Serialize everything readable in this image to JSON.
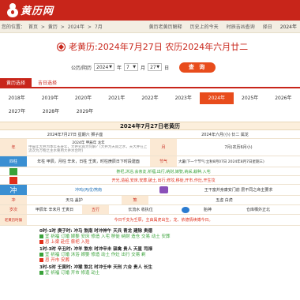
{
  "brand": {
    "logo_text": "黄历网"
  },
  "nav": {
    "crumbs": [
      "您的位置：",
      "首页",
      ">",
      "黄历",
      ">",
      "2024年",
      ">",
      "7月"
    ],
    "links": [
      "黄历老黄历解释",
      "历史上的今天",
      "时辰吉凶查询",
      "择日",
      "2024年"
    ]
  },
  "title": "老黄历:2024年7月27日 农历2024年六月廿二",
  "picker": {
    "label": "公历/阴历",
    "year": "2024",
    "month": "7",
    "day": "27",
    "search_label": "查 询"
  },
  "tabs": [
    "黄历选择",
    "吉日选择"
  ],
  "years": [
    [
      "2018年",
      "2019年",
      "2020年",
      "2021年",
      "2022年",
      "2023年",
      "2024年",
      "2025年",
      "2026年"
    ],
    [
      "2027年",
      "2028年",
      "2029年"
    ]
  ],
  "active_year": "2024年",
  "almanac": {
    "title": "2024年7月27日老黄历",
    "r1": {
      "left": "2024年7月27日 星期六 狮子座",
      "right": "2024年六月(小) 廿二 属龙"
    },
    "r2": {
      "label_l": "年",
      "mid_l": "2024年 甲辰年 龙年",
      "sub_l": "甲辰年大井为本年长寿年，大井究竟为何解？(大井为天雨之水，天大井在上流次为万物之主水要用大井水合时)",
      "label_r": "月",
      "right": "7月(农历6月小)"
    },
    "r3": {
      "label_l": "四柱",
      "left": "年柱 甲辰，月柱 辛未，日柱 壬寅，时柱庚辰日下时段建酉",
      "label_r": "节气",
      "right": "大暑(下一个节气:立秋8月07日 2024年8月7日星期三)"
    },
    "yi": "祭祀 沐浴 会亲友 出行 纳采 嫁娶 开市 订盟 入宅 动土 安床 修造 上梁",
    "yi_line": "祭祀,沐浴,会亲友,祈福,出行,纳财,嫁娶,纳采,栽种,入宅",
    "ji_line": "开光,造船,安床,安葬,破土,出行,修坟,移徙,开市,作灶,开生坟",
    "chong": "冲鸡(丙戌)煞南",
    "shen": "王干富并身康安门前 层不同之命主要求",
    "r7": {
      "a": "冲",
      "b": "煞",
      "c": "天马 盖护",
      "d": "五虚 白虎"
    },
    "r8": {
      "a": "岁次",
      "b": "甲辰年 辛未月 壬寅日",
      "c": "五行",
      "d": "长流水 收执位",
      "e": "胎神",
      "f": "仓库栖外正北"
    },
    "r9": {
      "label": "老黄历时辰",
      "text": "今日千支为壬辰，主由属虎出生，龙、依德情续傅今日。"
    },
    "hours": [
      {
        "head": "0时-1时 庚子时: 冲马 煞南 时冲神午 天兵 青龙 建除 贵德",
        "yi": "宜 祈福 订婚 嫁娶 安床 修造 入宅 移徙 纳财 造仓 交易 动土 安葬",
        "ji": "忌 上梁 赴任 祭祀 入殓"
      },
      {
        "head": "1时-3时 辛丑时: 冲羊 煞东 时冲辛未 驿禽 贵人 天星 司禄",
        "yi": "宜 祈福 订婚 沐浴 嫁娶 修造 动土 作灶 出行 交易 剃",
        "ji": "忌 开市 安葬"
      },
      {
        "head": "3时-5时 壬寅时: 冲猴 煞北 时冲壬申 天刑 六合 贵人 长生",
        "yi": "宜 祈福 订婚 开市 修造 动土",
        "ji": "忌 出行 安葬"
      }
    ]
  },
  "colors": {
    "brand_red": "#c8251a",
    "accent_orange": "#e84c1c",
    "table_cream": "#fbe9d4",
    "ji_green": "#3aa23a",
    "xiong_red": "#e0301c",
    "label_blue": "#3a8fd2"
  }
}
